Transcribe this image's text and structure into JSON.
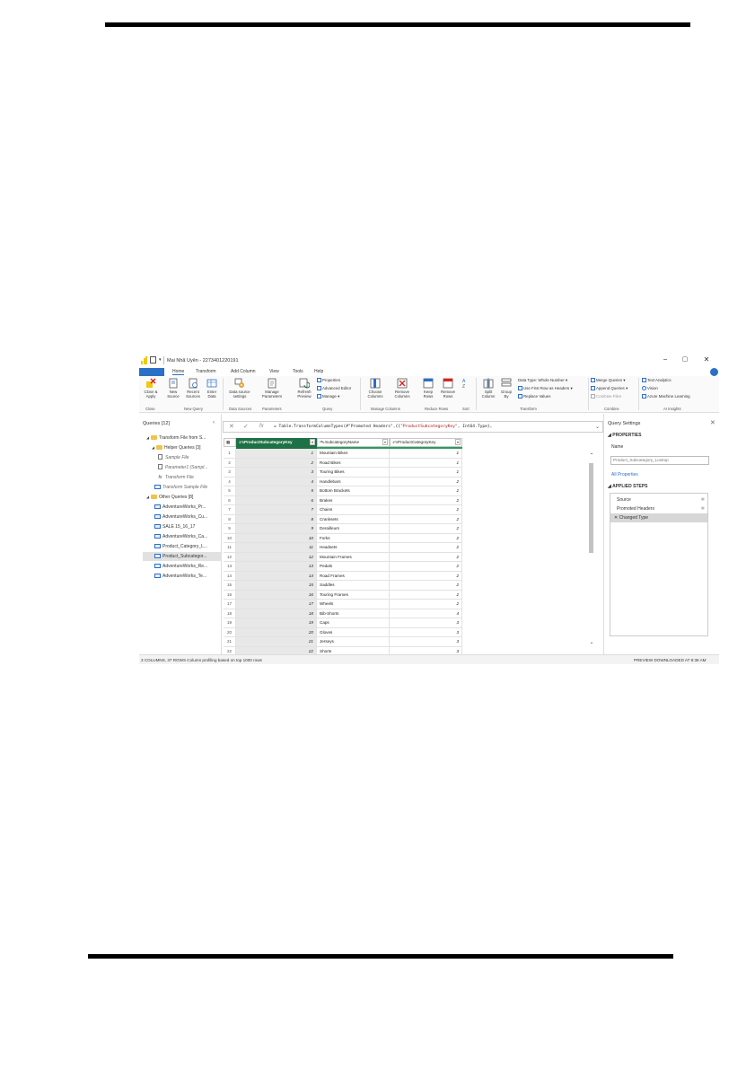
{
  "window": {
    "title": "Mai Nhã Uyên - 2273401220191",
    "minimize": "−",
    "maximize": "▢",
    "close": "✕"
  },
  "tabs": [
    {
      "label": "Home"
    },
    {
      "label": "Transform"
    },
    {
      "label": "Add Column"
    },
    {
      "label": "View"
    },
    {
      "label": "Tools"
    },
    {
      "label": "Help"
    }
  ],
  "ribbon": {
    "close_apply": "Close & Apply",
    "new_source": "New Source",
    "recent_sources": "Recent Sources",
    "enter_data": "Enter Data",
    "data_source_settings": "Data source settings",
    "manage_parameters": "Manage Parameters",
    "refresh_preview": "Refresh Preview",
    "properties": "Properties",
    "advanced_editor": "Advanced Editor",
    "manage": "Manage",
    "choose_columns": "Choose Columns",
    "remove_columns": "Remove Columns",
    "keep_rows": "Keep Rows",
    "remove_rows": "Remove Rows",
    "split_column": "Split Column",
    "group_by": "Group By",
    "data_type": "Data Type: Whole Number",
    "use_first_row": "Use First Row as Headers",
    "replace_values": "Replace Values",
    "merge_queries": "Merge Queries",
    "append_queries": "Append Queries",
    "combine_files": "Combine Files",
    "text_analytics": "Text Analytics",
    "vision": "Vision",
    "azure_ml": "Azure Machine Learning",
    "groups": {
      "close": "Close",
      "new_query": "New Query",
      "data_sources": "Data Sources",
      "parameters": "Parameters",
      "query": "Query",
      "manage_columns": "Manage Columns",
      "reduce_rows": "Reduce Rows",
      "sort": "Sort",
      "transform": "Transform",
      "combine": "Combine",
      "ai_insights": "AI Insights"
    }
  },
  "queries_pane": {
    "header": "Queries [12]",
    "collapse": "‹",
    "items": [
      {
        "label": "Transform File from S..."
      },
      {
        "label": "Helper Queries [3]"
      },
      {
        "label": "Sample File"
      },
      {
        "label": "Parameter1 (Sampl..."
      },
      {
        "label": "Transform File"
      },
      {
        "label": "Transform Sample File"
      },
      {
        "label": "Other Queries [8]"
      },
      {
        "label": "AdventureWorks_Pr..."
      },
      {
        "label": "AdventureWorks_Cu..."
      },
      {
        "label": "SALE 15_16_17"
      },
      {
        "label": "AdventureWorks_Ca..."
      },
      {
        "label": "Product_Category_L..."
      },
      {
        "label": "Product_Subcategor..."
      },
      {
        "label": "AdventureWorks_Re..."
      },
      {
        "label": "AdventureWorks_Te..."
      }
    ]
  },
  "formula_bar": {
    "prefix": "= Table.TransformColumnTypes(#\"Promoted Headers\",{{",
    "string": "\"ProductSubcategoryKey\"",
    "suffix": ", Int64.Type},",
    "expand": "⌄"
  },
  "grid": {
    "columns": [
      {
        "type": "1²3",
        "name": "ProductSubcategoryKey"
      },
      {
        "type": "ᴬᴮc",
        "name": "SubcategoryName"
      },
      {
        "type": "1²3",
        "name": "ProductCategoryKey"
      }
    ],
    "rows": [
      {
        "n": "1",
        "key": "1",
        "name": "Mountain Bikes",
        "cat": "1"
      },
      {
        "n": "2",
        "key": "2",
        "name": "Road Bikes",
        "cat": "1"
      },
      {
        "n": "3",
        "key": "3",
        "name": "Touring Bikes",
        "cat": "1"
      },
      {
        "n": "4",
        "key": "4",
        "name": "Handlebars",
        "cat": "2"
      },
      {
        "n": "5",
        "key": "5",
        "name": "Bottom Brackets",
        "cat": "2"
      },
      {
        "n": "6",
        "key": "6",
        "name": "Brakes",
        "cat": "2"
      },
      {
        "n": "7",
        "key": "7",
        "name": "Chains",
        "cat": "2"
      },
      {
        "n": "8",
        "key": "8",
        "name": "Cranksets",
        "cat": "2"
      },
      {
        "n": "9",
        "key": "9",
        "name": "Derailleurs",
        "cat": "2"
      },
      {
        "n": "10",
        "key": "10",
        "name": "Forks",
        "cat": "2"
      },
      {
        "n": "11",
        "key": "11",
        "name": "Headsets",
        "cat": "2"
      },
      {
        "n": "12",
        "key": "12",
        "name": "Mountain Frames",
        "cat": "2"
      },
      {
        "n": "13",
        "key": "13",
        "name": "Pedals",
        "cat": "2"
      },
      {
        "n": "14",
        "key": "14",
        "name": "Road Frames",
        "cat": "2"
      },
      {
        "n": "15",
        "key": "15",
        "name": "Saddles",
        "cat": "2"
      },
      {
        "n": "16",
        "key": "16",
        "name": "Touring Frames",
        "cat": "2"
      },
      {
        "n": "17",
        "key": "17",
        "name": "Wheels",
        "cat": "2"
      },
      {
        "n": "18",
        "key": "18",
        "name": "Bib-Shorts",
        "cat": "4"
      },
      {
        "n": "19",
        "key": "19",
        "name": "Caps",
        "cat": "3"
      },
      {
        "n": "20",
        "key": "20",
        "name": "Gloves",
        "cat": "3"
      },
      {
        "n": "21",
        "key": "21",
        "name": "Jerseys",
        "cat": "3"
      },
      {
        "n": "22",
        "key": "22",
        "name": "Shorts",
        "cat": "3"
      }
    ]
  },
  "settings": {
    "title": "Query Settings",
    "close": "✕",
    "properties_header": "PROPERTIES",
    "name_label": "Name",
    "name_value": "Product_Subcategory_Lookup",
    "all_properties": "All Properties",
    "applied_steps_header": "APPLIED STEPS",
    "steps": [
      {
        "label": "Source"
      },
      {
        "label": "Promoted Headers"
      },
      {
        "label": "Changed Type"
      }
    ]
  },
  "status": {
    "left": "3 COLUMNS, 37 ROWS    Column profiling based on top 1000 rows",
    "right": "PREVIEW DOWNLOADED AT 8:36 AM"
  },
  "colors": {
    "accent": "#2b6fc7",
    "selected_column": "#1e7145",
    "folder": "#f2c24a",
    "logo": "#f2c811"
  }
}
